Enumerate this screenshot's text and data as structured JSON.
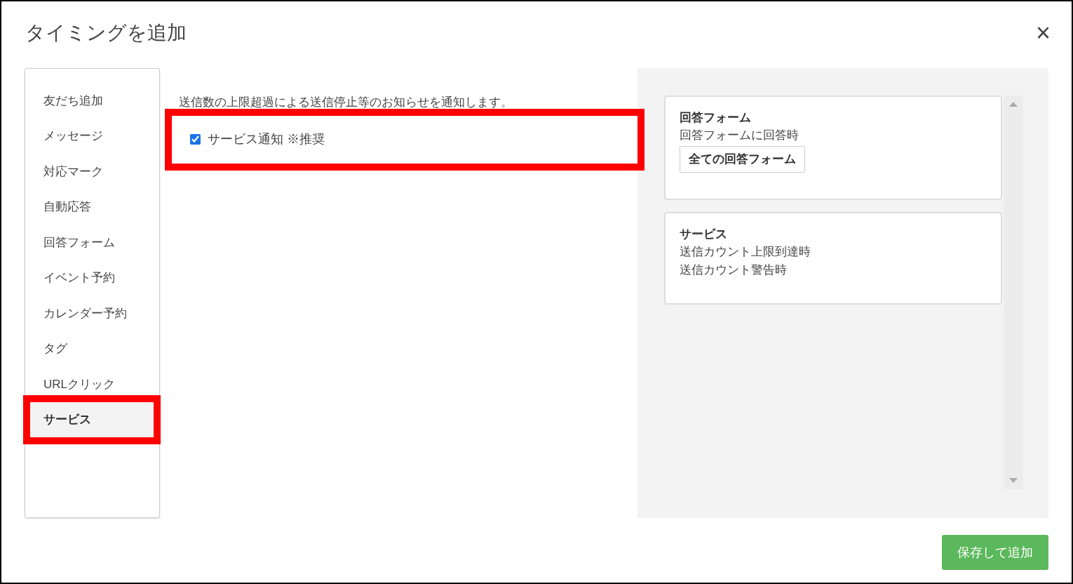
{
  "dialog": {
    "title": "タイミングを追加",
    "close": "×"
  },
  "sidebar": {
    "items": [
      {
        "label": "友だち追加",
        "selected": false,
        "highlighted": false
      },
      {
        "label": "メッセージ",
        "selected": false,
        "highlighted": false
      },
      {
        "label": "対応マーク",
        "selected": false,
        "highlighted": false
      },
      {
        "label": "自動応答",
        "selected": false,
        "highlighted": false
      },
      {
        "label": "回答フォーム",
        "selected": false,
        "highlighted": false
      },
      {
        "label": "イベント予約",
        "selected": false,
        "highlighted": false
      },
      {
        "label": "カレンダー予約",
        "selected": false,
        "highlighted": false
      },
      {
        "label": "タグ",
        "selected": false,
        "highlighted": false
      },
      {
        "label": "URLクリック",
        "selected": false,
        "highlighted": false
      },
      {
        "label": "サービス",
        "selected": true,
        "highlighted": true
      }
    ]
  },
  "content": {
    "description": "送信数の上限超過による送信停止等のお知らせを通知します。",
    "options": [
      {
        "label": "サービス通知 ※推奨",
        "checked": true,
        "highlighted": true
      }
    ]
  },
  "selected_panel": {
    "cards": [
      {
        "title": "回答フォーム",
        "lines": [
          "回答フォームに回答時"
        ],
        "tags": [
          "全ての回答フォーム"
        ]
      },
      {
        "title": "サービス",
        "lines": [
          "送信カウント上限到達時",
          "送信カウント警告時"
        ]
      }
    ]
  },
  "footer": {
    "save_button": "保存して追加"
  }
}
